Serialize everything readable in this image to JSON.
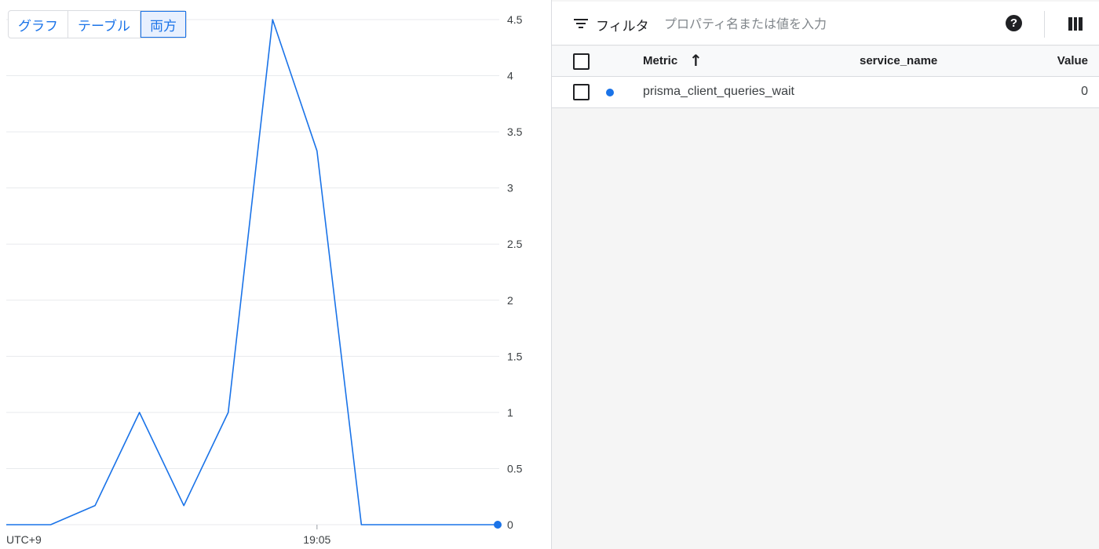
{
  "view_toggle": {
    "options": [
      "グラフ",
      "テーブル",
      "両方"
    ],
    "selected": "両方"
  },
  "chart_data": {
    "type": "line",
    "x": [
      "18:58",
      "18:59",
      "19:00",
      "19:01",
      "19:02",
      "19:03",
      "19:04",
      "19:05",
      "19:06",
      "19:07",
      "19:08",
      "19:09"
    ],
    "series": [
      {
        "values": [
          0,
          0,
          0.17,
          1,
          0.17,
          1,
          4.5,
          3.33,
          0,
          0,
          0,
          0
        ]
      }
    ],
    "yticks": [
      "0",
      "0.5",
      "1",
      "1.5",
      "2",
      "2.5",
      "3",
      "3.5",
      "4",
      "4.5"
    ],
    "ylim": [
      0,
      4.5
    ],
    "xtick_labels": [
      {
        "label": "19:05",
        "index": 7
      }
    ],
    "timezone_label": "UTC+9",
    "line_color": "#1a73e8",
    "grid": true,
    "y_axis_position": "right"
  },
  "filter": {
    "label": "フィルタ",
    "placeholder": "プロパティ名または値を入力",
    "value": ""
  },
  "icons": {
    "filter": "filter-icon",
    "help": "help-icon",
    "columns": "columns-icon",
    "help_glyph": "?"
  },
  "table": {
    "columns": [
      "Metric",
      "service_name",
      "Value"
    ],
    "sort_arrow": "↑",
    "rows": [
      {
        "metric": "prisma_client_queries_wait",
        "service_name": "",
        "value": "0",
        "color": "#1a73e8"
      }
    ]
  }
}
